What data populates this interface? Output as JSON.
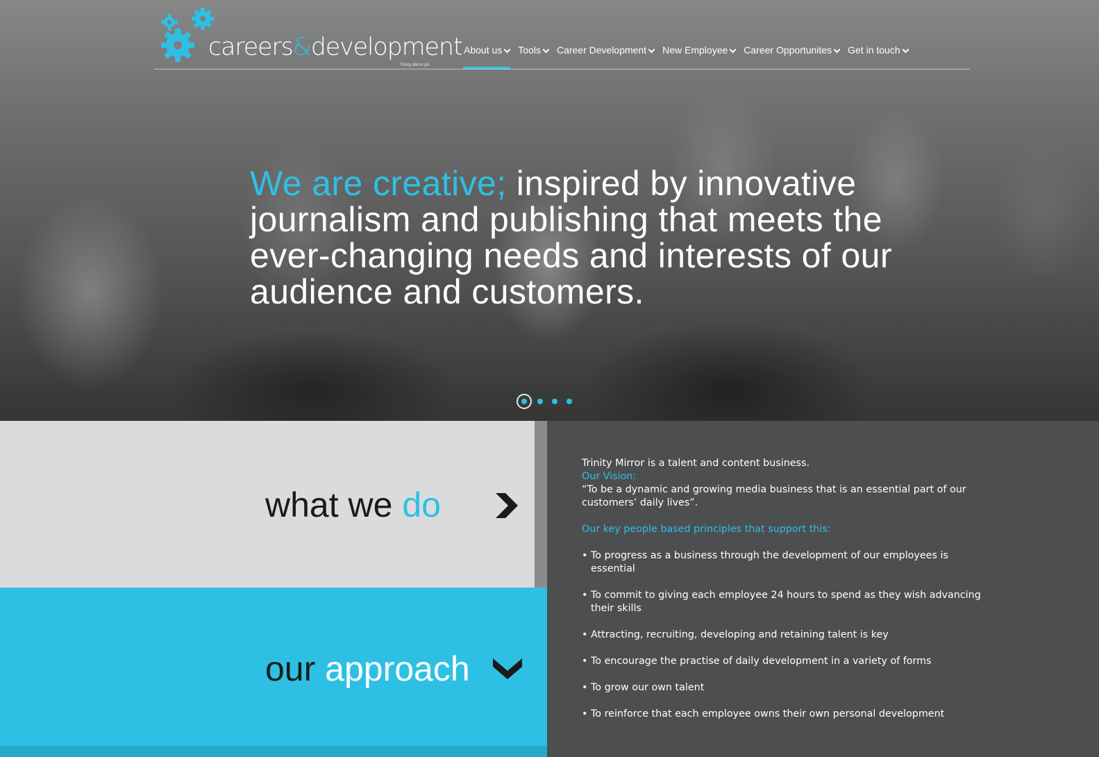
{
  "logo": {
    "name_part1": "careers",
    "ampersand": "&",
    "name_part2": "development",
    "subtitle": "Trinity Mirror plc"
  },
  "nav": {
    "items": [
      {
        "label": "About us",
        "active": true
      },
      {
        "label": "Tools",
        "active": false
      },
      {
        "label": "Career Development",
        "active": false
      },
      {
        "label": "New Employee",
        "active": false
      },
      {
        "label": "Career Opportunites",
        "active": false
      },
      {
        "label": "Get in touch",
        "active": false
      }
    ]
  },
  "hero": {
    "headline_accent": "We are creative;",
    "headline_rest": " inspired by innovative journalism and publishing that meets the ever-changing needs and interests of our audience and customers.",
    "slides_total": 4,
    "slide_active": 1
  },
  "panels": {
    "what_we_do": {
      "part1": "what we ",
      "part2": "do"
    },
    "our_approach": {
      "part1": "our ",
      "part2": "approach"
    }
  },
  "content": {
    "intro": "Trinity Mirror is a talent and content business.",
    "vision_label": "Our Vision:",
    "vision_text": "“To be a dynamic and growing media business that is an essential part of our customers’ daily lives”.",
    "principles_heading": "Our key people based principles that support this:",
    "principles": [
      "To progress as a business through the development of our employees is essential",
      "To commit to giving each employee 24 hours to spend as they wish advancing their skills",
      "Attracting, recruiting, developing and retaining talent is key",
      "To encourage the practise of daily development in a variety of forms",
      "To grow our own talent",
      "To reinforce that each employee owns their own personal development"
    ]
  },
  "colors": {
    "accent": "#2ec0e4",
    "dark_panel": "#4d4e50",
    "light_panel": "#dadbdc"
  },
  "icons": [
    "gears-logo-icon",
    "chevron-down-icon",
    "arrow-right-icon",
    "arrow-down-icon"
  ]
}
